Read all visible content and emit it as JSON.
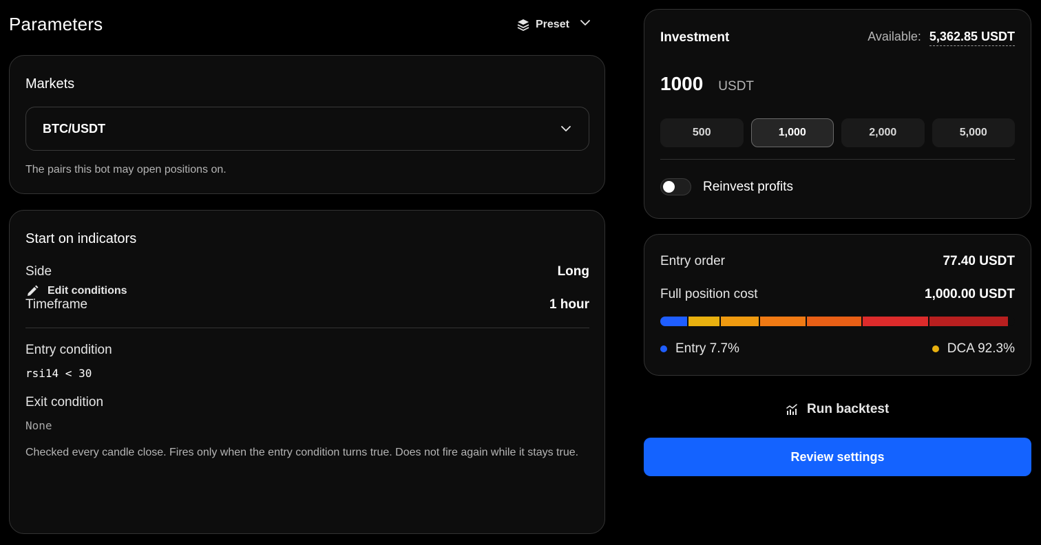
{
  "header": {
    "title": "Parameters",
    "preset_label": "Preset",
    "preset_icon": "layers-icon"
  },
  "markets": {
    "title": "Markets",
    "selected": "BTC/USDT",
    "hint": "The pairs this bot may open positions on."
  },
  "start": {
    "title": "Start on indicators",
    "side_label": "Side",
    "side_value": "Long",
    "timeframe_label": "Timeframe",
    "timeframe_value": "1 hour",
    "entry_label": "Entry condition",
    "entry_value": "rsi14 < 30",
    "exit_label": "Exit condition",
    "exit_value": "None",
    "hint": "Checked every candle close. Fires only when the entry condition turns true. Does not fire again while it stays true.",
    "edit_label": "Edit conditions"
  },
  "investment": {
    "title": "Investment",
    "available_label": "Available:",
    "available_value": "5,362.85 USDT",
    "amount": "1000",
    "currency": "USDT",
    "chips": [
      "500",
      "1,000",
      "2,000",
      "5,000"
    ],
    "selected_chip": "1,000",
    "reinvest_label": "Reinvest profits",
    "reinvest_enabled": false
  },
  "orders": {
    "entry_label": "Entry order",
    "entry_value": "77.40 USDT",
    "full_label": "Full position cost",
    "full_value": "1,000.00 USDT",
    "segments": [
      {
        "fraction": 0.077,
        "color": "#1f5eff"
      },
      {
        "fraction": 0.09,
        "color": "#e8b00f"
      },
      {
        "fraction": 0.11,
        "color": "#ef9a10"
      },
      {
        "fraction": 0.13,
        "color": "#f07a14"
      },
      {
        "fraction": 0.157,
        "color": "#e85f16"
      },
      {
        "fraction": 0.19,
        "color": "#dc2b2b"
      },
      {
        "fraction": 0.226,
        "color": "#b81f1f"
      }
    ],
    "legend_entry": "Entry 7.7%",
    "legend_entry_color": "#1f5eff",
    "legend_dca": "DCA 92.3%",
    "legend_dca_color": "#e8b00f"
  },
  "actions": {
    "backtest_label": "Run backtest",
    "backtest_icon": "chart-icon",
    "review_label": "Review settings",
    "accent": "#1463ff"
  }
}
